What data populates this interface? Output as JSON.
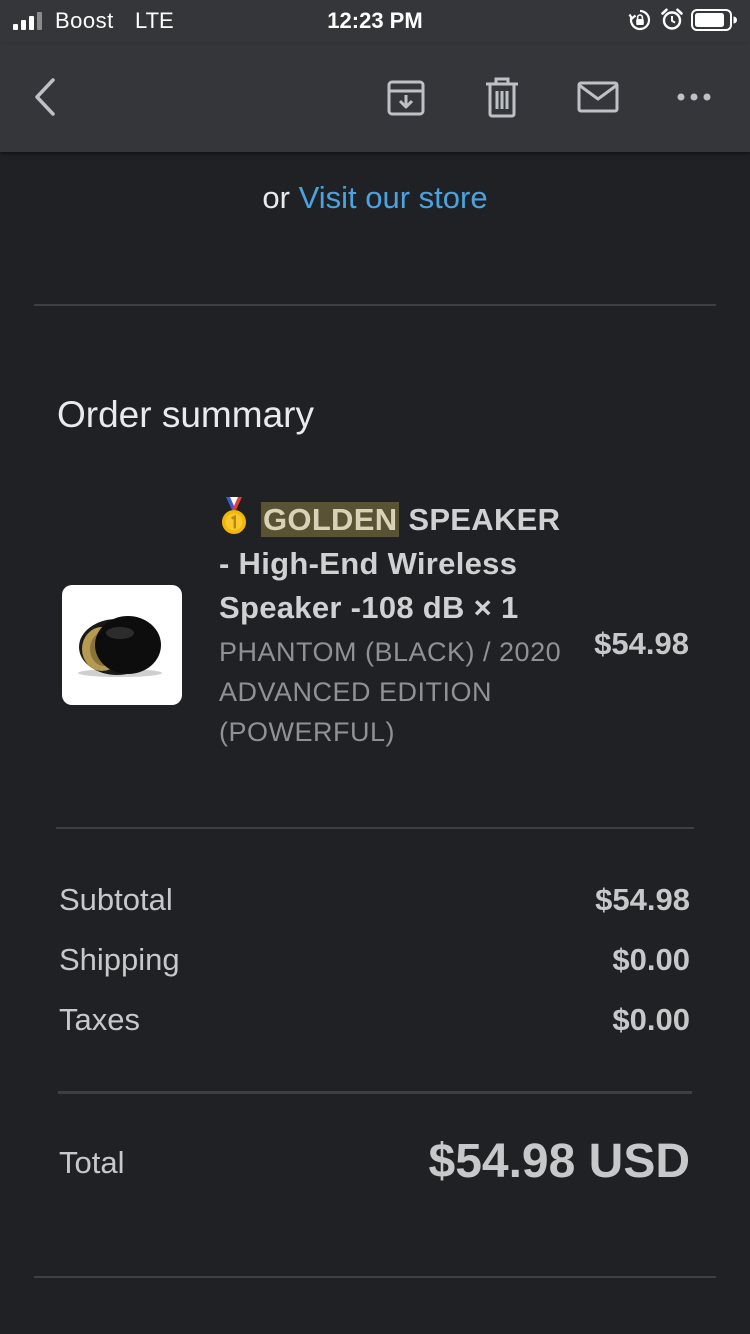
{
  "status_bar": {
    "carrier": "Boost",
    "network": "LTE",
    "time": "12:23 PM"
  },
  "toolbar": {
    "icons": [
      "chevron-left-icon",
      "archive-icon",
      "trash-icon",
      "mail-icon",
      "more-horizontal-icon"
    ]
  },
  "email": {
    "store_prefix": "or ",
    "store_link": "Visit our store",
    "link_color": "#4aa3df",
    "order_summary": {
      "title": "Order summary",
      "item": {
        "highlight": "GOLDEN",
        "name_rest": "SPEAKER - High-End Wireless Speaker -108 dB × 1",
        "variant": "PHANTOM (BLACK) / 2020 ADVANCED EDITION  (POWERFUL)",
        "price": "$54.98"
      },
      "lines": [
        {
          "label": "Subtotal",
          "value": "$54.98"
        },
        {
          "label": "Shipping",
          "value": "$0.00"
        },
        {
          "label": "Taxes",
          "value": "$0.00"
        }
      ],
      "total": {
        "label": "Total",
        "value": "$54.98 USD"
      }
    }
  }
}
